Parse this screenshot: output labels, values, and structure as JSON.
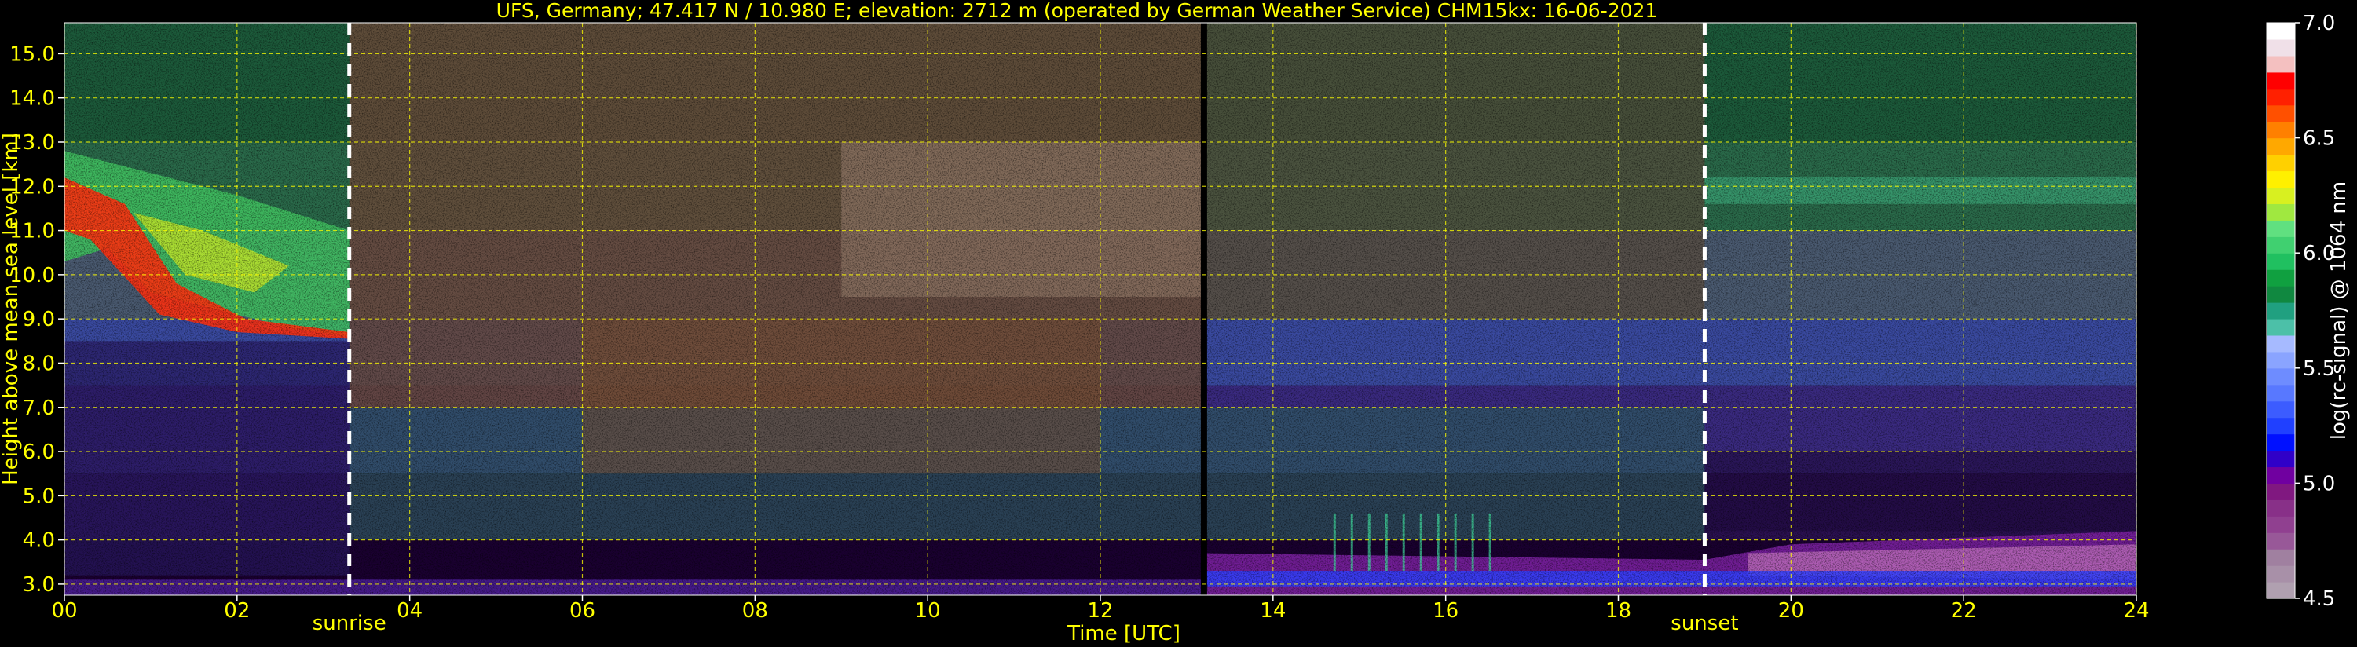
{
  "chart_data": {
    "type": "heatmap",
    "title": "UFS, Germany; 47.417 N / 10.980 E; elevation: 2712 m  (operated by German Weather Service)    CHM15kx: 16-06-2021",
    "xlabel": "Time [UTC]",
    "ylabel": "Height above mean sea level [km]",
    "xlim": [
      0,
      24
    ],
    "ylim": [
      2.75,
      15.7
    ],
    "x_ticks": [
      "00",
      "02",
      "04",
      "06",
      "08",
      "10",
      "12",
      "14",
      "16",
      "18",
      "20",
      "22",
      "24"
    ],
    "y_ticks": [
      "3.0",
      "4.0",
      "5.0",
      "6.0",
      "7.0",
      "8.0",
      "9.0",
      "10.0",
      "11.0",
      "12.0",
      "13.0",
      "14.0",
      "15.0"
    ],
    "grid": true,
    "colorbar": {
      "label": "log(rc-signal) @ 1064 nm",
      "range": [
        4.5,
        7.0
      ],
      "ticks": [
        "4.5",
        "5.0",
        "5.5",
        "6.0",
        "6.5",
        "7.0"
      ],
      "colors": [
        "#b0a0b0",
        "#a890a8",
        "#a080a0",
        "#985898",
        "#904090",
        "#883088",
        "#801880",
        "#7000a0",
        "#3000c8",
        "#0010ff",
        "#2040ff",
        "#3c5cff",
        "#5878ff",
        "#6e8cff",
        "#8aa4ff",
        "#a6baff",
        "#4cc0a8",
        "#20a080",
        "#108840",
        "#10a040",
        "#20c060",
        "#40d070",
        "#60e080",
        "#a0e840",
        "#d8f020",
        "#fff000",
        "#ffd000",
        "#ffa800",
        "#ff8000",
        "#ff5000",
        "#ff2000",
        "#ff0000",
        "#f4c0c0",
        "#f0e0e8",
        "#ffffff"
      ]
    },
    "events": [
      {
        "label": "sunrise",
        "time": 3.3
      },
      {
        "label": "sunset",
        "time": 19.0
      }
    ],
    "cloud_layer": {
      "height_range_km": [
        8.5,
        12.8
      ],
      "time_range_utc": [
        0,
        3.3
      ]
    },
    "missing_data_time": 13.2,
    "accent_color": "#ffff00"
  }
}
